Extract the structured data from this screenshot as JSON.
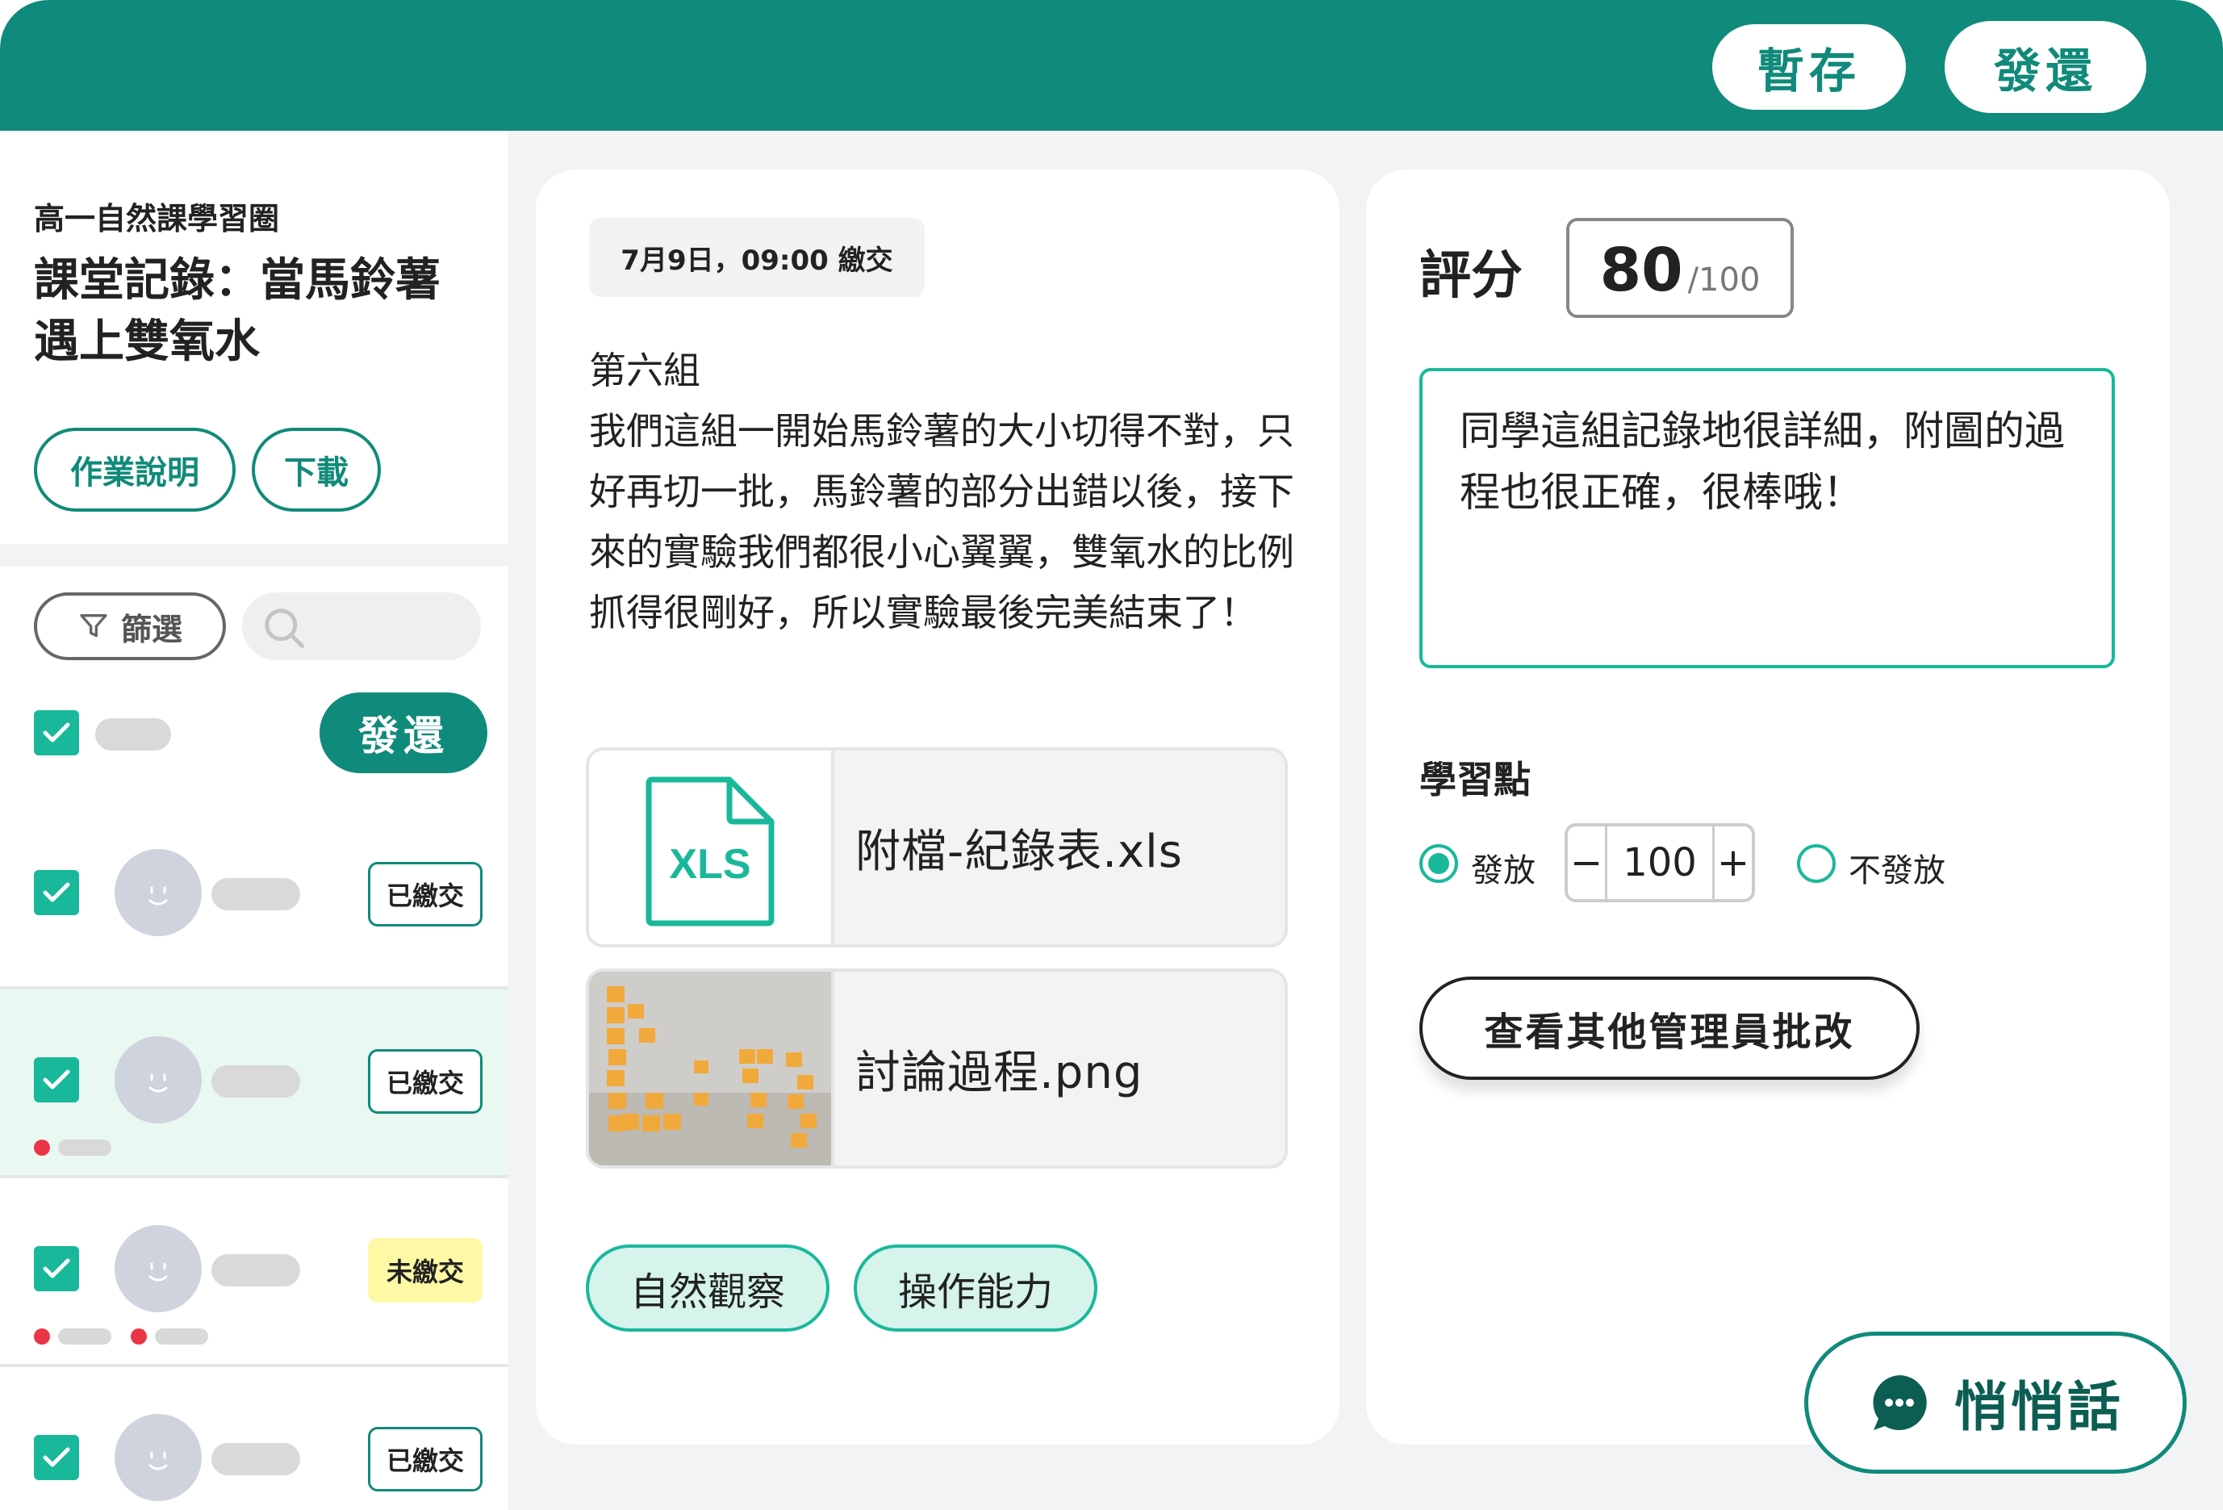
{
  "header": {
    "save_label": "暫存",
    "return_label": "發還"
  },
  "sidebar": {
    "course": "高一自然課學習圈",
    "title": "課堂記錄：當馬鈴薯遇上雙氧水",
    "instructions_label": "作業說明",
    "download_label": "下載",
    "filter_label": "篩選",
    "bulk_return_label": "發還",
    "students": [
      {
        "status": "已繳交",
        "selected": false
      },
      {
        "status": "已繳交",
        "selected": true
      },
      {
        "status": "未繳交",
        "selected": false
      },
      {
        "status": "已繳交",
        "selected": false
      }
    ]
  },
  "submission": {
    "timestamp": "7月9日，09:00 繳交",
    "text": "第六組\n我們這組一開始馬鈴薯的大小切得不對，只好再切一批，馬鈴薯的部分出錯以後，接下來的實驗我們都很小心翼翼，雙氧水的比例抓得很剛好，所以實驗最後完美結束了！",
    "files": [
      {
        "name": "附檔-紀錄表.xls",
        "icon": "XLS"
      },
      {
        "name": "討論過程.png"
      }
    ],
    "tags": [
      "自然觀察",
      "操作能力"
    ]
  },
  "grading": {
    "score_label": "評分",
    "score": "80",
    "score_max": "/100",
    "comment": "同學這組記錄地很詳細，附圖的過程也很正確，很棒哦！",
    "points_label": "學習點",
    "give_label": "發放",
    "no_give_label": "不發放",
    "points_value": "100",
    "minus": "−",
    "plus": "+",
    "admin_review_label": "查看其他管理員批改"
  },
  "whisper_label": "悄悄話",
  "colors": {
    "brand": "#108a7a",
    "accent": "#19b89b",
    "pending": "#fff9a6",
    "alert": "#ea3546"
  }
}
